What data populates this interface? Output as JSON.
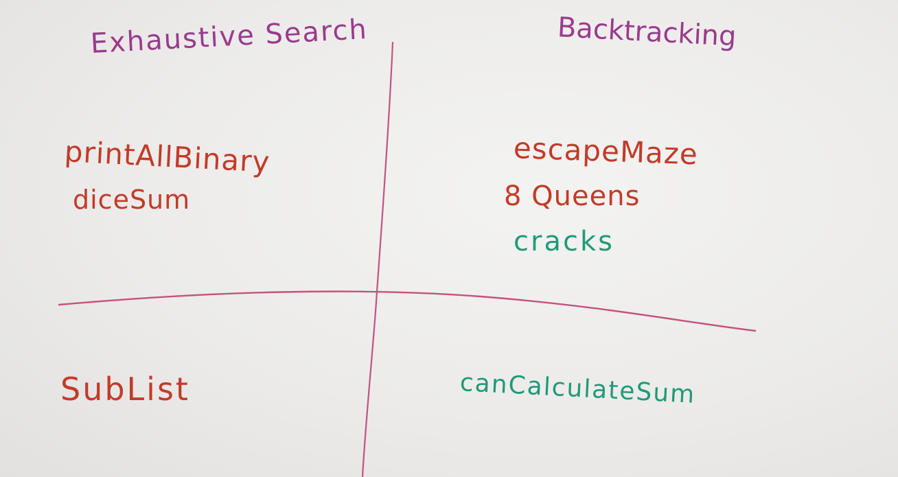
{
  "colors": {
    "purple_marker": "#9a3a8c",
    "red_marker": "#c23b28",
    "teal_marker": "#1f9a78",
    "pink_line": "#c4527e",
    "board": "#ecebea"
  },
  "quadrants": {
    "left_heading": "Exhaustive Search",
    "right_heading": "Backtracking",
    "exhaustive_items": [
      "printAllBinary",
      "diceSum"
    ],
    "backtracking_items": [
      "escapeMaze",
      "8 Queens",
      "cracks"
    ],
    "bottom_left_items": [
      "SubList"
    ],
    "bottom_right_items": [
      "canCalculateSum"
    ]
  }
}
